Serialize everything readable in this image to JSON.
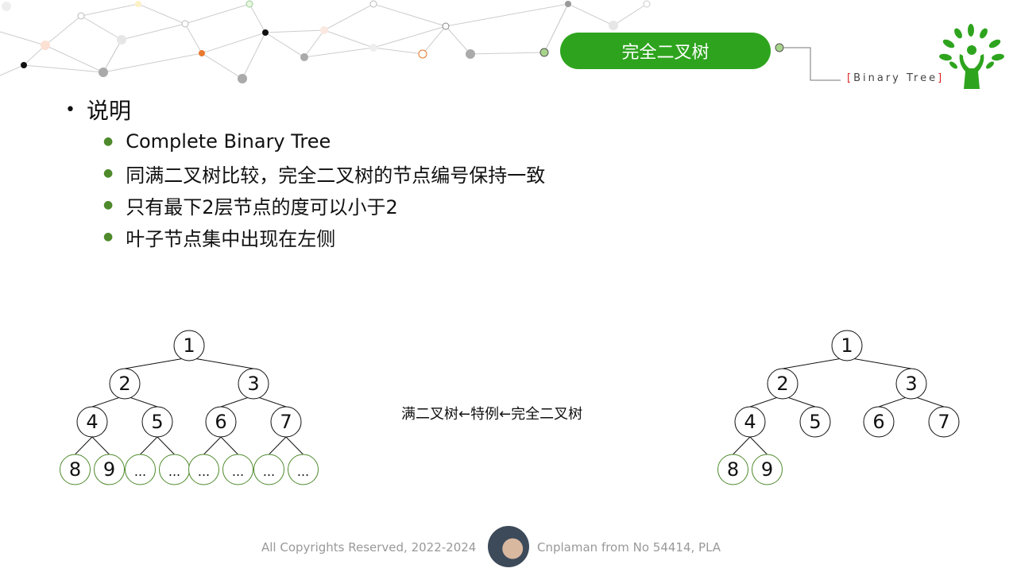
{
  "header": {
    "title": "完全二叉树",
    "subtitle": "Binary Tree",
    "accent": "#2ea41e"
  },
  "content": {
    "heading": "说明",
    "items": [
      "Complete Binary Tree",
      "同满二叉树比较，完全二叉树的节点编号保持一致",
      "只有最下2层节点的度可以小于2",
      "叶子节点集中出现在左侧"
    ]
  },
  "diagram": {
    "left_tree": [
      "1",
      "2",
      "3",
      "4",
      "5",
      "6",
      "7",
      "8",
      "9",
      "...",
      "...",
      "...",
      "...",
      "...",
      "..."
    ],
    "right_tree": [
      "1",
      "2",
      "3",
      "4",
      "5",
      "6",
      "7",
      "8",
      "9"
    ],
    "caption": "满二叉树←特例←完全二叉树"
  },
  "footer": {
    "copyright": "All Copyrights Reserved, 2022-2024",
    "author": "Cnplaman from No 54414, PLA"
  },
  "icons": {
    "logo": "tree-hands-logo",
    "avatar": "author-avatar"
  }
}
